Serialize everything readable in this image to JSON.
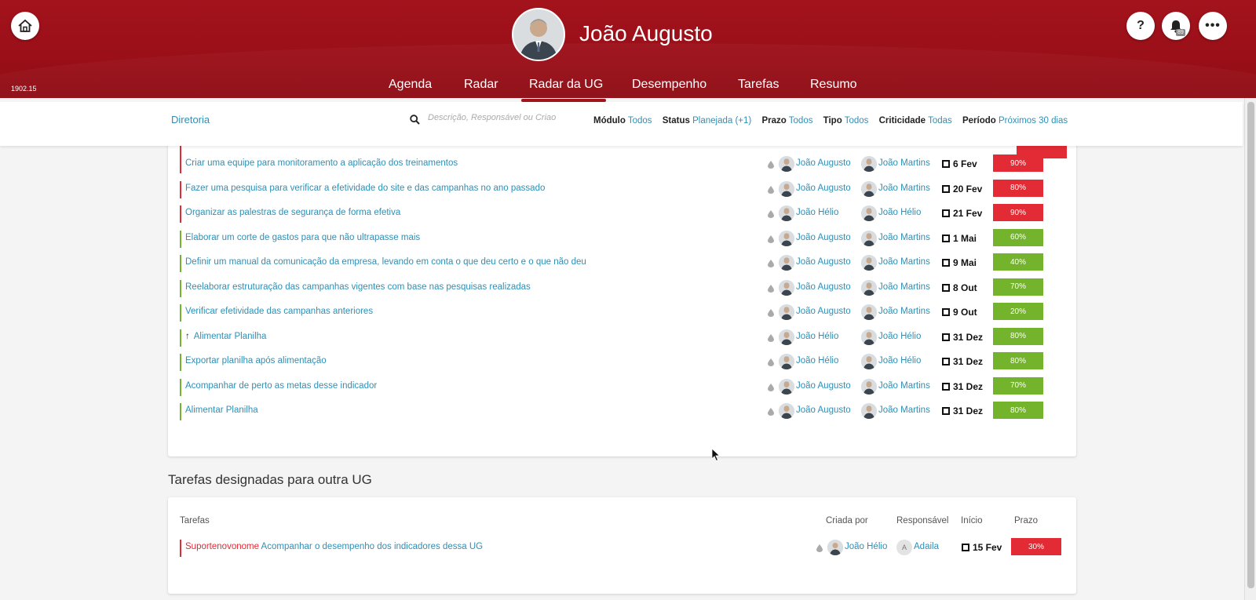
{
  "header": {
    "user_name": "João Augusto",
    "version": "1902.15",
    "notifications_count": "89",
    "help_label": "?",
    "more_label": "•••",
    "nav": [
      "Agenda",
      "Radar",
      "Radar da UG",
      "Desempenho",
      "Tarefas",
      "Resumo"
    ],
    "active_nav": "Radar da UG"
  },
  "filters": {
    "unit": "Diretoria",
    "search_placeholder": "Descrição, Responsável ou Criao",
    "items": [
      {
        "label": "Módulo",
        "value": "Todos"
      },
      {
        "label": "Status",
        "value": "Planejada (+1)"
      },
      {
        "label": "Prazo",
        "value": "Todos"
      },
      {
        "label": "Tipo",
        "value": "Todos"
      },
      {
        "label": "Criticidade",
        "value": "Todas"
      },
      {
        "label": "Período",
        "value": "Próximos 30 dias"
      }
    ]
  },
  "tasks": [
    {
      "title": "Criar uma equipe para monitoramento a aplicação dos treinamentos",
      "creator": "João Augusto",
      "responsible": "João Martins",
      "date": "6 Fev",
      "percent": "90%",
      "status": "red"
    },
    {
      "title": "Fazer uma pesquisa para verificar a efetividade do site e das campanhas no ano passado",
      "creator": "João Augusto",
      "responsible": "João Martins",
      "date": "20 Fev",
      "percent": "80%",
      "status": "red"
    },
    {
      "title": "Organizar as palestras de segurança de forma efetiva",
      "creator": "João Hélio",
      "responsible": "João Hélio",
      "date": "21 Fev",
      "percent": "90%",
      "status": "red"
    },
    {
      "title": "Elaborar um corte de gastos para que não ultrapasse mais",
      "creator": "João Augusto",
      "responsible": "João Martins",
      "date": "1 Mai",
      "percent": "60%",
      "status": "green"
    },
    {
      "title": "Definir um manual da comunicação da empresa, levando em conta o que deu certo e o que não deu",
      "creator": "João Augusto",
      "responsible": "João Martins",
      "date": "9 Mai",
      "percent": "40%",
      "status": "green"
    },
    {
      "title": "Reelaborar estruturação das campanhas vigentes com base nas pesquisas realizadas",
      "creator": "João Augusto",
      "responsible": "João Martins",
      "date": "8 Out",
      "percent": "70%",
      "status": "green"
    },
    {
      "title": "Verificar efetividade das campanhas anteriores",
      "creator": "João Augusto",
      "responsible": "João Martins",
      "date": "9 Out",
      "percent": "20%",
      "status": "green"
    },
    {
      "title": "Alimentar Planilha",
      "arrow": "↑",
      "creator": "João Hélio",
      "responsible": "João Hélio",
      "date": "31 Dez",
      "percent": "80%",
      "status": "green"
    },
    {
      "title": "Exportar planilha após alimentação",
      "creator": "João Hélio",
      "responsible": "João Hélio",
      "date": "31 Dez",
      "percent": "80%",
      "status": "green"
    },
    {
      "title": "Acompanhar de perto as metas desse indicador",
      "creator": "João Augusto",
      "responsible": "João Martins",
      "date": "31 Dez",
      "percent": "70%",
      "status": "green"
    },
    {
      "title": "Alimentar Planilha",
      "creator": "João Augusto",
      "responsible": "João Martins",
      "date": "31 Dez",
      "percent": "80%",
      "status": "green"
    }
  ],
  "other_ug": {
    "section_title": "Tarefas designadas para outra UG",
    "headers": {
      "tasks": "Tarefas",
      "created_by": "Criada por",
      "responsible": "Responsável",
      "start": "Início",
      "deadline": "Prazo"
    },
    "rows": [
      {
        "ug": "Suportenovonome",
        "title": "Acompanhar o desempenho dos indicadores dessa UG",
        "creator": "João Hélio",
        "responsible_initial": "A",
        "responsible": "Adaila",
        "date": "15 Fev",
        "percent": "30%",
        "status": "red"
      }
    ]
  },
  "colors": {
    "brand": "#a3131c",
    "link": "#2f8fb5",
    "late": "#e22b35",
    "on_time": "#74b32c"
  }
}
